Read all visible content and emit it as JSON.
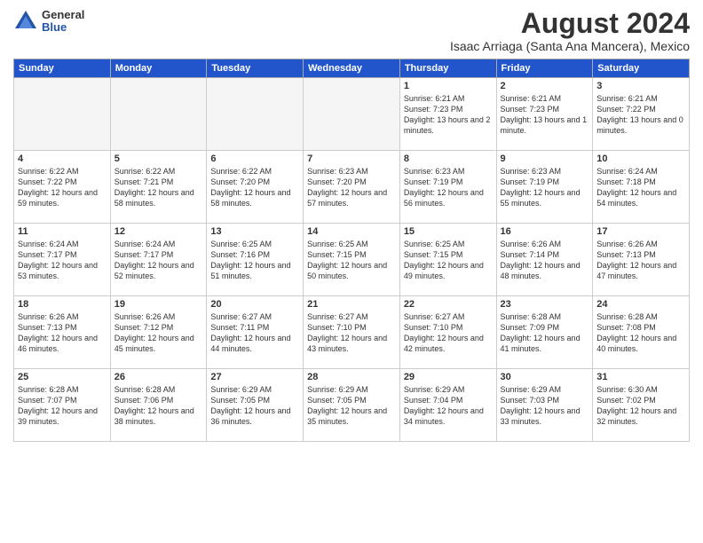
{
  "header": {
    "logo_general": "General",
    "logo_blue": "Blue",
    "month_year": "August 2024",
    "location": "Isaac Arriaga (Santa Ana Mancera), Mexico"
  },
  "days_of_week": [
    "Sunday",
    "Monday",
    "Tuesday",
    "Wednesday",
    "Thursday",
    "Friday",
    "Saturday"
  ],
  "weeks": [
    [
      {
        "day": "",
        "empty": true
      },
      {
        "day": "",
        "empty": true
      },
      {
        "day": "",
        "empty": true
      },
      {
        "day": "",
        "empty": true
      },
      {
        "day": "1",
        "sunrise": "6:21 AM",
        "sunset": "7:23 PM",
        "daylight": "13 hours and 2 minutes."
      },
      {
        "day": "2",
        "sunrise": "6:21 AM",
        "sunset": "7:23 PM",
        "daylight": "13 hours and 1 minute."
      },
      {
        "day": "3",
        "sunrise": "6:21 AM",
        "sunset": "7:22 PM",
        "daylight": "13 hours and 0 minutes."
      }
    ],
    [
      {
        "day": "4",
        "sunrise": "6:22 AM",
        "sunset": "7:22 PM",
        "daylight": "12 hours and 59 minutes."
      },
      {
        "day": "5",
        "sunrise": "6:22 AM",
        "sunset": "7:21 PM",
        "daylight": "12 hours and 58 minutes."
      },
      {
        "day": "6",
        "sunrise": "6:22 AM",
        "sunset": "7:20 PM",
        "daylight": "12 hours and 58 minutes."
      },
      {
        "day": "7",
        "sunrise": "6:23 AM",
        "sunset": "7:20 PM",
        "daylight": "12 hours and 57 minutes."
      },
      {
        "day": "8",
        "sunrise": "6:23 AM",
        "sunset": "7:19 PM",
        "daylight": "12 hours and 56 minutes."
      },
      {
        "day": "9",
        "sunrise": "6:23 AM",
        "sunset": "7:19 PM",
        "daylight": "12 hours and 55 minutes."
      },
      {
        "day": "10",
        "sunrise": "6:24 AM",
        "sunset": "7:18 PM",
        "daylight": "12 hours and 54 minutes."
      }
    ],
    [
      {
        "day": "11",
        "sunrise": "6:24 AM",
        "sunset": "7:17 PM",
        "daylight": "12 hours and 53 minutes."
      },
      {
        "day": "12",
        "sunrise": "6:24 AM",
        "sunset": "7:17 PM",
        "daylight": "12 hours and 52 minutes."
      },
      {
        "day": "13",
        "sunrise": "6:25 AM",
        "sunset": "7:16 PM",
        "daylight": "12 hours and 51 minutes."
      },
      {
        "day": "14",
        "sunrise": "6:25 AM",
        "sunset": "7:15 PM",
        "daylight": "12 hours and 50 minutes."
      },
      {
        "day": "15",
        "sunrise": "6:25 AM",
        "sunset": "7:15 PM",
        "daylight": "12 hours and 49 minutes."
      },
      {
        "day": "16",
        "sunrise": "6:26 AM",
        "sunset": "7:14 PM",
        "daylight": "12 hours and 48 minutes."
      },
      {
        "day": "17",
        "sunrise": "6:26 AM",
        "sunset": "7:13 PM",
        "daylight": "12 hours and 47 minutes."
      }
    ],
    [
      {
        "day": "18",
        "sunrise": "6:26 AM",
        "sunset": "7:13 PM",
        "daylight": "12 hours and 46 minutes."
      },
      {
        "day": "19",
        "sunrise": "6:26 AM",
        "sunset": "7:12 PM",
        "daylight": "12 hours and 45 minutes."
      },
      {
        "day": "20",
        "sunrise": "6:27 AM",
        "sunset": "7:11 PM",
        "daylight": "12 hours and 44 minutes."
      },
      {
        "day": "21",
        "sunrise": "6:27 AM",
        "sunset": "7:10 PM",
        "daylight": "12 hours and 43 minutes."
      },
      {
        "day": "22",
        "sunrise": "6:27 AM",
        "sunset": "7:10 PM",
        "daylight": "12 hours and 42 minutes."
      },
      {
        "day": "23",
        "sunrise": "6:28 AM",
        "sunset": "7:09 PM",
        "daylight": "12 hours and 41 minutes."
      },
      {
        "day": "24",
        "sunrise": "6:28 AM",
        "sunset": "7:08 PM",
        "daylight": "12 hours and 40 minutes."
      }
    ],
    [
      {
        "day": "25",
        "sunrise": "6:28 AM",
        "sunset": "7:07 PM",
        "daylight": "12 hours and 39 minutes."
      },
      {
        "day": "26",
        "sunrise": "6:28 AM",
        "sunset": "7:06 PM",
        "daylight": "12 hours and 38 minutes."
      },
      {
        "day": "27",
        "sunrise": "6:29 AM",
        "sunset": "7:05 PM",
        "daylight": "12 hours and 36 minutes."
      },
      {
        "day": "28",
        "sunrise": "6:29 AM",
        "sunset": "7:05 PM",
        "daylight": "12 hours and 35 minutes."
      },
      {
        "day": "29",
        "sunrise": "6:29 AM",
        "sunset": "7:04 PM",
        "daylight": "12 hours and 34 minutes."
      },
      {
        "day": "30",
        "sunrise": "6:29 AM",
        "sunset": "7:03 PM",
        "daylight": "12 hours and 33 minutes."
      },
      {
        "day": "31",
        "sunrise": "6:30 AM",
        "sunset": "7:02 PM",
        "daylight": "12 hours and 32 minutes."
      }
    ]
  ]
}
